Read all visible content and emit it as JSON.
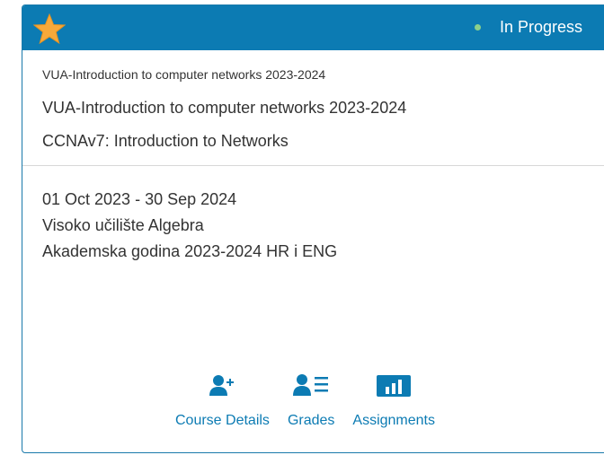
{
  "header": {
    "favorite_icon": "star-icon",
    "status_label": "In Progress",
    "status_color": "#8bd08b",
    "brand_color": "#0c7bb3"
  },
  "course": {
    "short_title": "VUA-Introduction to computer networks 2023-2024",
    "long_title": "VUA-Introduction to computer networks 2023-2024",
    "curriculum": "CCNAv7: Introduction to Networks",
    "dates": "01 Oct 2023 - 30 Sep 2024",
    "institution": "Visoko učilište Algebra",
    "term": "Akademska godina 2023-2024 HR i ENG"
  },
  "actions": {
    "course_details": {
      "label": "Course Details",
      "icon": "user-plus-icon"
    },
    "grades": {
      "label": "Grades",
      "icon": "user-list-icon"
    },
    "assignments": {
      "label": "Assignments",
      "icon": "bar-chart-icon"
    }
  }
}
